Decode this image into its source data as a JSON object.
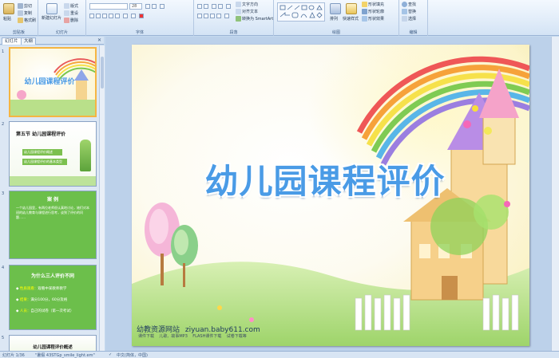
{
  "ribbon": {
    "clipboard": {
      "label": "剪贴板",
      "paste": "粘贴",
      "cut": "剪切",
      "copy": "复制",
      "format_painter": "格式刷"
    },
    "slides": {
      "label": "幻灯片",
      "new_slide": "新建幻灯片",
      "layout": "版式",
      "reset": "重设",
      "delete": "删除"
    },
    "font": {
      "label": "字体",
      "font_size": "28"
    },
    "paragraph": {
      "label": "段落",
      "text_direction": "文字方向",
      "align_text": "对齐文本",
      "smartart": "转换为 SmartArt"
    },
    "drawing": {
      "label": "绘图",
      "arrange": "排列",
      "quick_styles": "快速样式",
      "shape_fill": "形状填充",
      "shape_outline": "形状轮廓",
      "shape_effects": "形状效果"
    },
    "editing": {
      "label": "编辑",
      "find": "查找",
      "replace": "替换",
      "select": "选择"
    }
  },
  "pane": {
    "tab_slides": "幻灯片",
    "tab_outline": "大纲"
  },
  "thumbs": [
    {
      "num": "1",
      "title": "幼儿园课程评价"
    },
    {
      "num": "2",
      "title": "第五节  幼儿园课程评价",
      "box1": "幼儿园课程评价概述",
      "box2": "幼儿园课程评价的基本类型"
    },
    {
      "num": "3",
      "title": "案 例",
      "body": "一个幼儿园里，有两位老师很认真地讨论，她们对本班的幼儿教育与课程进行思考，谈到了评价的问题……"
    },
    {
      "num": "4",
      "title": "为什么三人评价不同",
      "item1_key": "性质观看：",
      "item1_val": "观看中某教师教学",
      "item2_key": "结果：",
      "item2_val": "满分100分，60分及格",
      "item3_key": "人员：",
      "item3_val": "自己的试卷（第一次考试）"
    },
    {
      "num": "5",
      "title": "幼儿园课程评价概述"
    }
  ],
  "slide": {
    "title": "幼儿园课程评价",
    "footer_site": "幼教资源网站",
    "footer_url": "ziyuan.baby611.com",
    "footer_links": "课件下载    儿歌、故事MP3    FLASH课件下载    试卷下载等"
  },
  "status": {
    "slide_info": "幻灯片 1/36",
    "theme": "\"暑假 43STGp_smile_light.em\"",
    "language": "中文(简体，中国)"
  },
  "colors": {
    "title_blue": "#4a9be6",
    "ribbon_bg": "#dfeaf7",
    "selection": "#f5b542"
  }
}
